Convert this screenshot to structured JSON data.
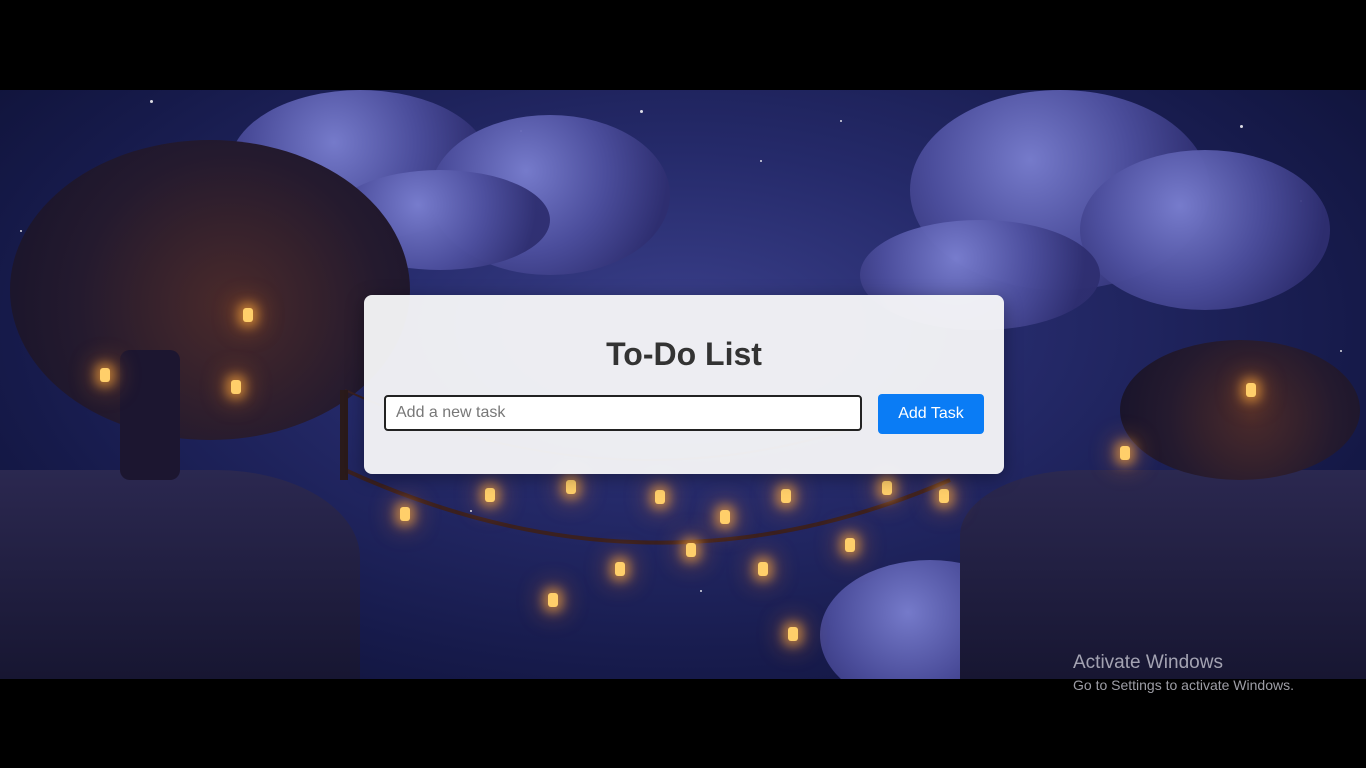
{
  "app": {
    "title": "To-Do List",
    "input_placeholder": "Add a new task",
    "input_value": "",
    "add_button_label": "Add Task"
  },
  "watermark": {
    "title": "Activate Windows",
    "subtitle": "Go to Settings to activate Windows."
  },
  "colors": {
    "accent": "#0a7cf5",
    "card_background": "#f5f5f7",
    "title_text": "#333333"
  }
}
